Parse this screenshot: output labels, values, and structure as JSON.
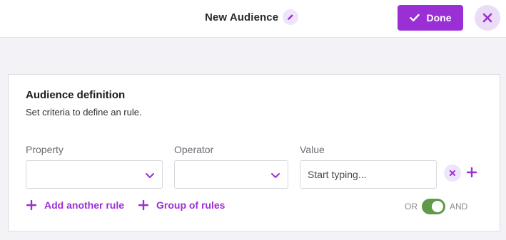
{
  "header": {
    "title": "New Audience",
    "done_label": "Done"
  },
  "card": {
    "title": "Audience definition",
    "subtitle": "Set criteria to define an rule.",
    "fields": {
      "property_label": "Property",
      "operator_label": "Operator",
      "value_label": "Value",
      "property_value": "",
      "operator_value": "",
      "value_placeholder": "Start typing..."
    },
    "actions": {
      "add_rule_label": "Add another rule",
      "group_rules_label": "Group of rules"
    },
    "logic": {
      "or_label": "OR",
      "and_label": "AND",
      "selected": "AND"
    }
  },
  "icons": {
    "edit": "pencil-icon",
    "done": "check-icon",
    "close": "close-icon",
    "dropdown": "chevron-down-icon",
    "remove": "remove-rule-icon",
    "add": "plus-icon"
  },
  "colors": {
    "accent": "#9b2fd6",
    "accent_light": "#efe4fb",
    "toggle_on": "#5f9a48",
    "background": "#f3f3f7"
  }
}
